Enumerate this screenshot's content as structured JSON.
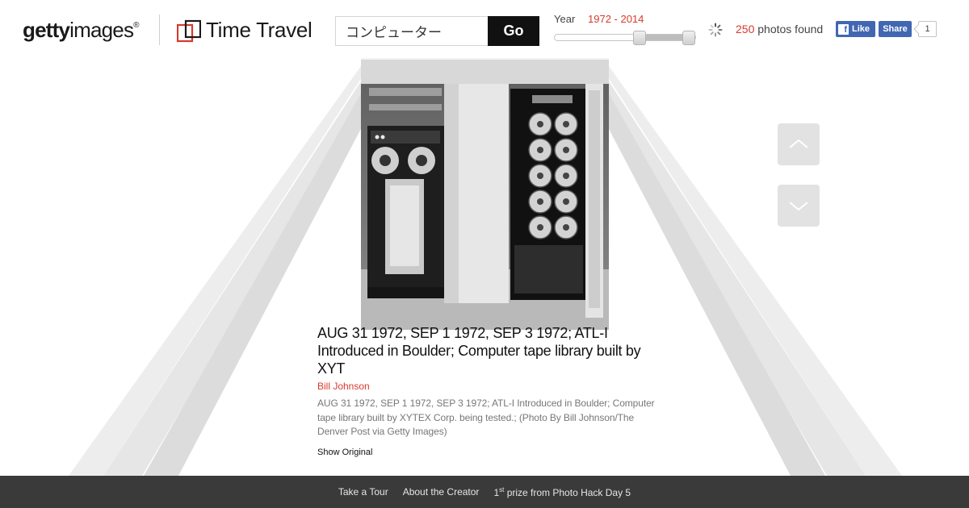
{
  "header": {
    "logo": {
      "bold": "getty",
      "rest": "images",
      "mark": "®"
    },
    "app_title": "Time Travel",
    "search": {
      "value": "コンピューター",
      "placeholder": ""
    },
    "go_label": "Go",
    "year": {
      "label": "Year",
      "range": "1972 - 2014"
    },
    "results": {
      "count": "250",
      "suffix": "photos found"
    },
    "social": {
      "like_label": "Like",
      "share_label": "Share",
      "share_count": "1"
    }
  },
  "photo": {
    "title": "AUG 31 1972, SEP 1 1972, SEP 3 1972; ATL-I Introduced in Boulder; Computer tape library built by XYT",
    "author": "Bill Johnson",
    "description": "AUG 31 1972, SEP 1 1972, SEP 3 1972; ATL-I Introduced in Boulder; Computer tape library built by XYTEX Corp. being tested.; (Photo By Bill Johnson/The Denver Post via Getty Images)",
    "show_original": "Show Original"
  },
  "nav": {
    "up_icon": "chevron-up-icon",
    "down_icon": "chevron-down-icon"
  },
  "footer": {
    "tour": "Take a Tour",
    "creator": "About the Creator",
    "prize_ordinal": "1",
    "prize_suffix": "st",
    "prize_text": "prize from Photo Hack Day 5"
  },
  "colors": {
    "accent": "#d73a2d",
    "facebook": "#4267b2",
    "footer_bg": "#3a3a3a",
    "go_button": "#111111"
  }
}
